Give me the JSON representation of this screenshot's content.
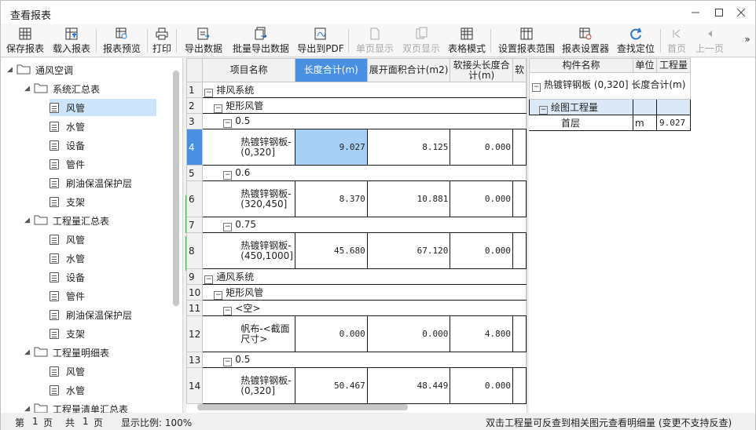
{
  "window": {
    "title": "查看报表"
  },
  "toolbar": [
    {
      "label": "保存报表",
      "icon": "save-report-icon",
      "enabled": true
    },
    {
      "label": "载入报表",
      "icon": "load-report-icon",
      "enabled": true
    },
    {
      "label": "报表预览",
      "icon": "report-preview-icon",
      "enabled": true
    },
    {
      "label": "打印",
      "icon": "printer-icon",
      "enabled": true
    },
    {
      "label": "导出数据",
      "icon": "export-data-icon",
      "enabled": true
    },
    {
      "label": "批量导出数据",
      "icon": "batch-export-icon",
      "enabled": true
    },
    {
      "label": "导出到PDF",
      "icon": "export-pdf-icon",
      "enabled": true
    },
    {
      "label": "单页显示",
      "icon": "single-page-icon",
      "enabled": false
    },
    {
      "label": "双页显示",
      "icon": "double-page-icon",
      "enabled": false
    },
    {
      "label": "表格模式",
      "icon": "table-mode-icon",
      "enabled": true
    },
    {
      "label": "设置报表范围",
      "icon": "report-range-icon",
      "enabled": true
    },
    {
      "label": "报表设置器",
      "icon": "report-settings-icon",
      "enabled": true
    },
    {
      "label": "查找定位",
      "icon": "find-locate-icon",
      "enabled": true
    },
    {
      "label": "首页",
      "icon": "first-page-icon",
      "enabled": false
    },
    {
      "label": "上一页",
      "icon": "prev-page-icon",
      "enabled": false
    }
  ],
  "tree": [
    {
      "label": "通风空调",
      "level": 0,
      "type": "folder"
    },
    {
      "label": "系统汇总表",
      "level": 1,
      "type": "folder"
    },
    {
      "label": "风管",
      "level": 2,
      "type": "doc",
      "selected": true
    },
    {
      "label": "水管",
      "level": 2,
      "type": "doc"
    },
    {
      "label": "设备",
      "level": 2,
      "type": "doc"
    },
    {
      "label": "管件",
      "level": 2,
      "type": "doc"
    },
    {
      "label": "刷油保温保护层",
      "level": 2,
      "type": "doc"
    },
    {
      "label": "支架",
      "level": 2,
      "type": "doc"
    },
    {
      "label": "工程量汇总表",
      "level": 1,
      "type": "folder"
    },
    {
      "label": "风管",
      "level": 2,
      "type": "doc"
    },
    {
      "label": "水管",
      "level": 2,
      "type": "doc"
    },
    {
      "label": "设备",
      "level": 2,
      "type": "doc"
    },
    {
      "label": "管件",
      "level": 2,
      "type": "doc"
    },
    {
      "label": "刷油保温保护层",
      "level": 2,
      "type": "doc"
    },
    {
      "label": "支架",
      "level": 2,
      "type": "doc"
    },
    {
      "label": "工程量明细表",
      "level": 1,
      "type": "folder"
    },
    {
      "label": "风管",
      "level": 2,
      "type": "doc"
    },
    {
      "label": "水管",
      "level": 2,
      "type": "doc"
    },
    {
      "label": "工程量清单汇总表",
      "level": 1,
      "type": "folder"
    }
  ],
  "grid": {
    "headers": [
      "项目名称",
      "长度合计(m)",
      "展开面积合计(m2)",
      "软接头长度合计(m)",
      "软"
    ],
    "rows": [
      {
        "n": "1",
        "indent": 0,
        "label": "排风系统",
        "group": true
      },
      {
        "n": "2",
        "indent": 1,
        "label": "矩形风管",
        "group": true
      },
      {
        "n": "3",
        "indent": 2,
        "label": "0.5",
        "group": true
      },
      {
        "n": "4",
        "indent": 3,
        "label": "热镀锌钢板-(0,320]",
        "v1": "9.027",
        "v2": "8.125",
        "v3": "0.000",
        "hl": true
      },
      {
        "n": "5",
        "indent": 2,
        "label": "0.6",
        "group": true
      },
      {
        "n": "6",
        "indent": 3,
        "label": "热镀锌钢板-(320,450]",
        "v1": "8.370",
        "v2": "10.881",
        "v3": "0.000"
      },
      {
        "n": "7",
        "indent": 2,
        "label": "0.75",
        "group": true
      },
      {
        "n": "8",
        "indent": 3,
        "label": "热镀锌钢板-(450,1000]",
        "v1": "45.680",
        "v2": "67.120",
        "v3": "0.000"
      },
      {
        "n": "9",
        "indent": 0,
        "label": "通风系统",
        "group": true
      },
      {
        "n": "10",
        "indent": 1,
        "label": "矩形风管",
        "group": true
      },
      {
        "n": "11",
        "indent": 2,
        "label": "<空>",
        "group": true
      },
      {
        "n": "12",
        "indent": 3,
        "label": "帆布-<截面尺寸>",
        "v1": "0.000",
        "v2": "0.000",
        "v3": "4.800"
      },
      {
        "n": "13",
        "indent": 2,
        "label": "0.5",
        "group": true
      },
      {
        "n": "14",
        "indent": 3,
        "label": "热镀锌钢板-(0,320]",
        "v1": "50.467",
        "v2": "48.449",
        "v3": "0.000"
      }
    ]
  },
  "detail": {
    "headers": [
      "构件名称",
      "单位",
      "工程量"
    ],
    "root": "热镀锌钢板 (0,320] 长度合计(m)",
    "group": "绘图工程量",
    "leaf": {
      "name": "首层",
      "unit": "m",
      "qty": "9.027"
    }
  },
  "status": {
    "page_label": "第",
    "page_num": "1",
    "page_unit": "页",
    "total_label": "共",
    "total_num": "1",
    "total_unit": "页",
    "zoom": "显示比例: 100%",
    "hint": "双击工程量可反查到相关图元查看明细量 (变更不支持反查)"
  }
}
